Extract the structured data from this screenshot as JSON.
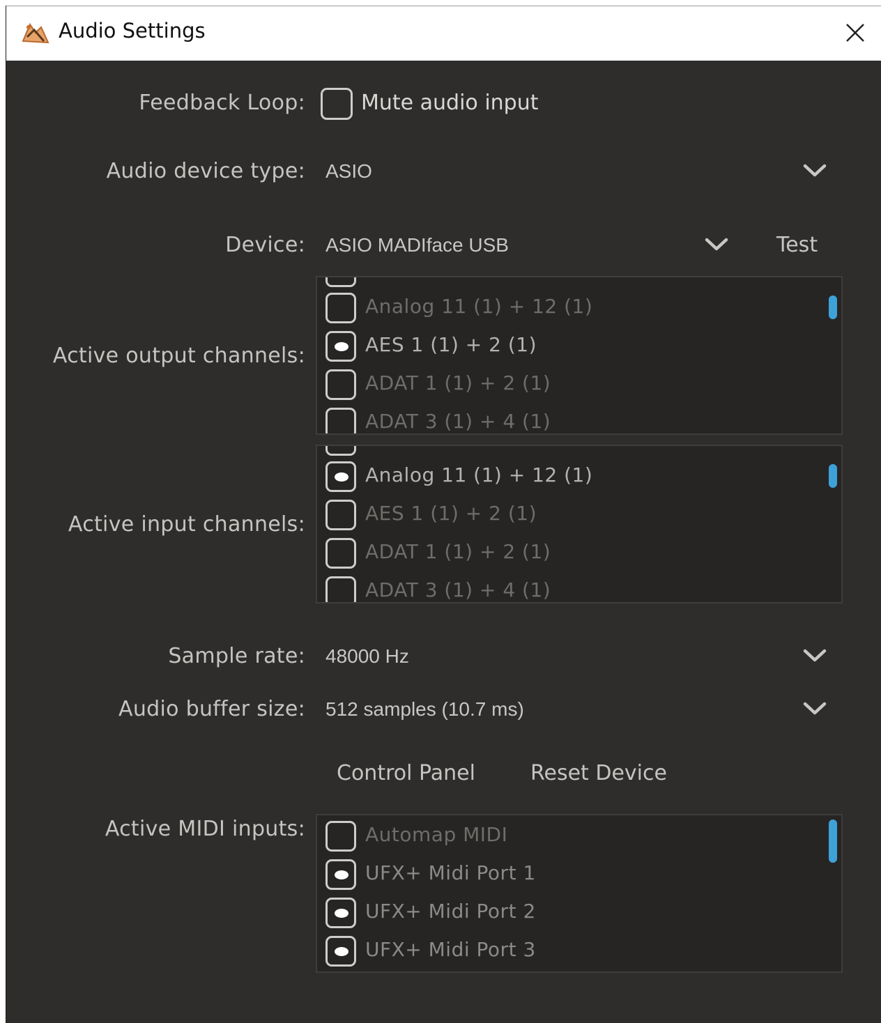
{
  "window": {
    "title": "Audio Settings",
    "app_icon": "app-logo-icon",
    "close_icon": "close-icon"
  },
  "feedback_loop": {
    "label": "Feedback Loop:",
    "checkbox_label": "Mute audio input",
    "checked": false
  },
  "audio_device_type": {
    "label": "Audio device type:",
    "value": "ASIO"
  },
  "device": {
    "label": "Device:",
    "value": "ASIO MADIface USB",
    "test_label": "Test"
  },
  "output_channels": {
    "label": "Active output channels:",
    "items": [
      {
        "label": "Analog 11 (1) + 12 (1)",
        "checked": false
      },
      {
        "label": "AES 1 (1) + 2 (1)",
        "checked": true
      },
      {
        "label": "ADAT 1 (1) + 2 (1)",
        "checked": false
      },
      {
        "label": "ADAT 3 (1) + 4 (1)",
        "checked": false
      }
    ]
  },
  "input_channels": {
    "label": "Active input channels:",
    "items": [
      {
        "label": "Analog 11 (1) + 12 (1)",
        "checked": true
      },
      {
        "label": "AES 1 (1) + 2 (1)",
        "checked": false
      },
      {
        "label": "ADAT 1 (1) + 2 (1)",
        "checked": false
      },
      {
        "label": "ADAT 3 (1) + 4 (1)",
        "checked": false
      }
    ]
  },
  "sample_rate": {
    "label": "Sample rate:",
    "value": "48000 Hz"
  },
  "buffer_size": {
    "label": "Audio buffer size:",
    "value": "512 samples (10.7 ms)"
  },
  "buttons": {
    "control_panel": "Control Panel",
    "reset_device": "Reset Device"
  },
  "midi_inputs": {
    "label": "Active MIDI inputs:",
    "items": [
      {
        "label": "Automap MIDI",
        "checked": false
      },
      {
        "label": "UFX+ Midi Port 1",
        "checked": true
      },
      {
        "label": "UFX+ Midi Port 2",
        "checked": true
      },
      {
        "label": "UFX+ Midi Port 3",
        "checked": true
      }
    ]
  },
  "colors": {
    "background": "#2e2d2c",
    "list_background": "#262524",
    "scrollbar_thumb": "#3ea2d8",
    "label_text": "#c6c4c1",
    "disabled_text": "#6f6d6a"
  }
}
